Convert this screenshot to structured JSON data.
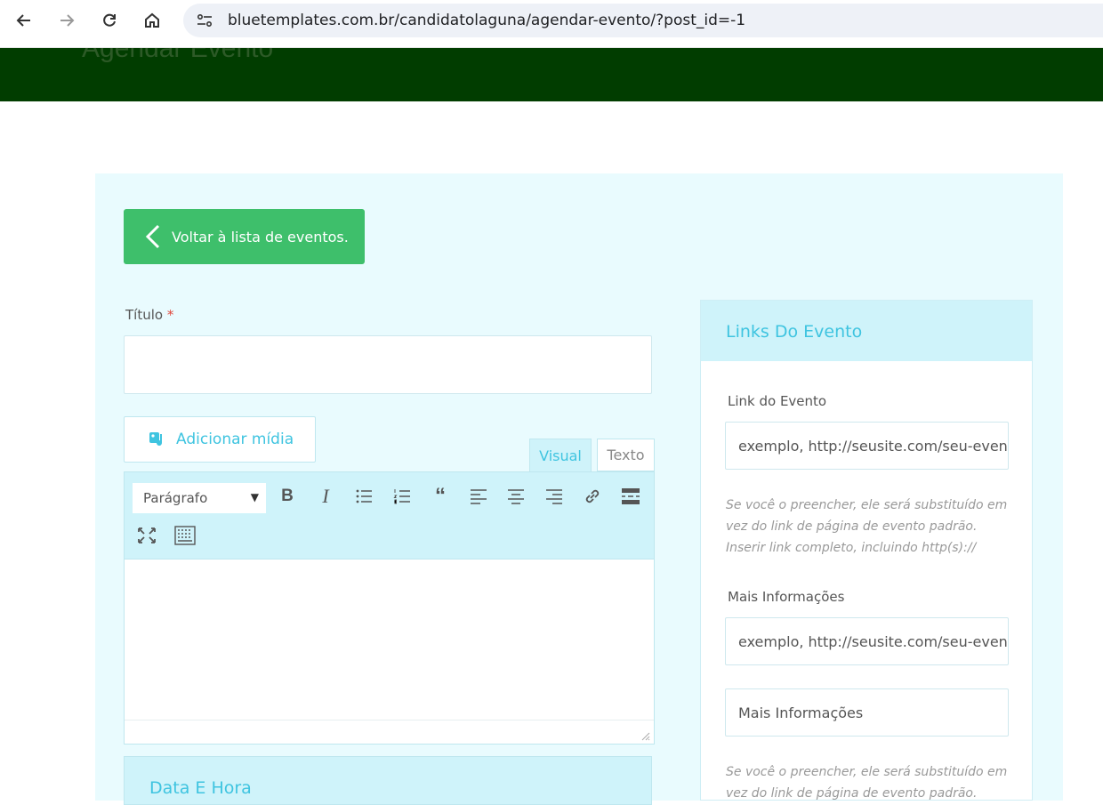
{
  "browser": {
    "url": "bluetemplates.com.br/candidatolaguna/agendar-evento/?post_id=-1"
  },
  "header": {
    "ghost_title": "Agendar Evento"
  },
  "form": {
    "back_label": "Voltar à lista de eventos.",
    "title_label": "Título",
    "required_mark": "*",
    "media_label": "Adicionar mídia",
    "tab_visual": "Visual",
    "tab_text": "Texto",
    "format_select": "Parágrafo",
    "date_panel_title": "Data E Hora"
  },
  "side": {
    "title": "Links Do Evento",
    "event_link_label": "Link do Evento",
    "event_link_placeholder": "exemplo, http://seusite.com/seu-even",
    "help_1": "Se você o preencher, ele será substituído em vez do link de página de evento padrão. Inserir link completo, incluindo http(s)://",
    "more_info_label": "Mais Informações",
    "more_info_placeholder": "exemplo, http://seusite.com/seu-even",
    "more_info_text_placeholder": "Mais Informações",
    "help_2": "Se você o preencher, ele será substituído em vez do link de página de evento padrão."
  },
  "colors": {
    "header_green": "#013d00",
    "button_green": "#3ebf6b",
    "accent_cyan": "#3fc4e0",
    "panel_bg": "#e9fbfe"
  }
}
